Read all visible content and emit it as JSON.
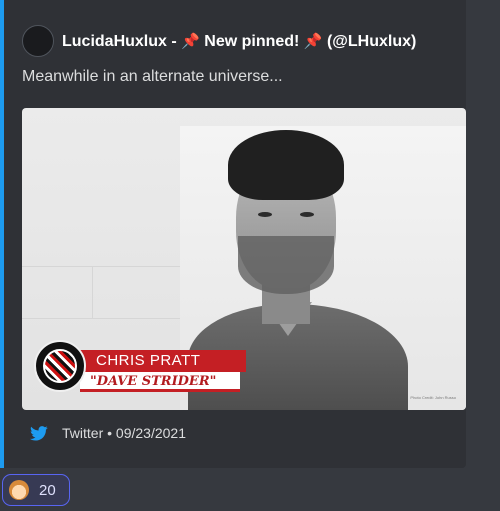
{
  "embed": {
    "accent_color": "#1d9bf0",
    "author": {
      "name": "LucidaHuxlux",
      "separator": " - ",
      "pin_emoji": "📌",
      "pinned_text": " New pinned! ",
      "handle": " (@LHuxlux)"
    },
    "description": "Meanwhile in an alternate universe...",
    "image": {
      "name_banner": "CHRIS PRATT",
      "role_banner": "\"DAVE STRIDER\"",
      "credit": "Photo Credit: John Russo"
    },
    "footer": {
      "icon": "twitter-icon",
      "source": "Twitter",
      "bullet": " • ",
      "date": "09/23/2021"
    }
  },
  "reaction": {
    "emoji": "person-emoji",
    "count": "20",
    "highlight_color": "#5865f2"
  }
}
